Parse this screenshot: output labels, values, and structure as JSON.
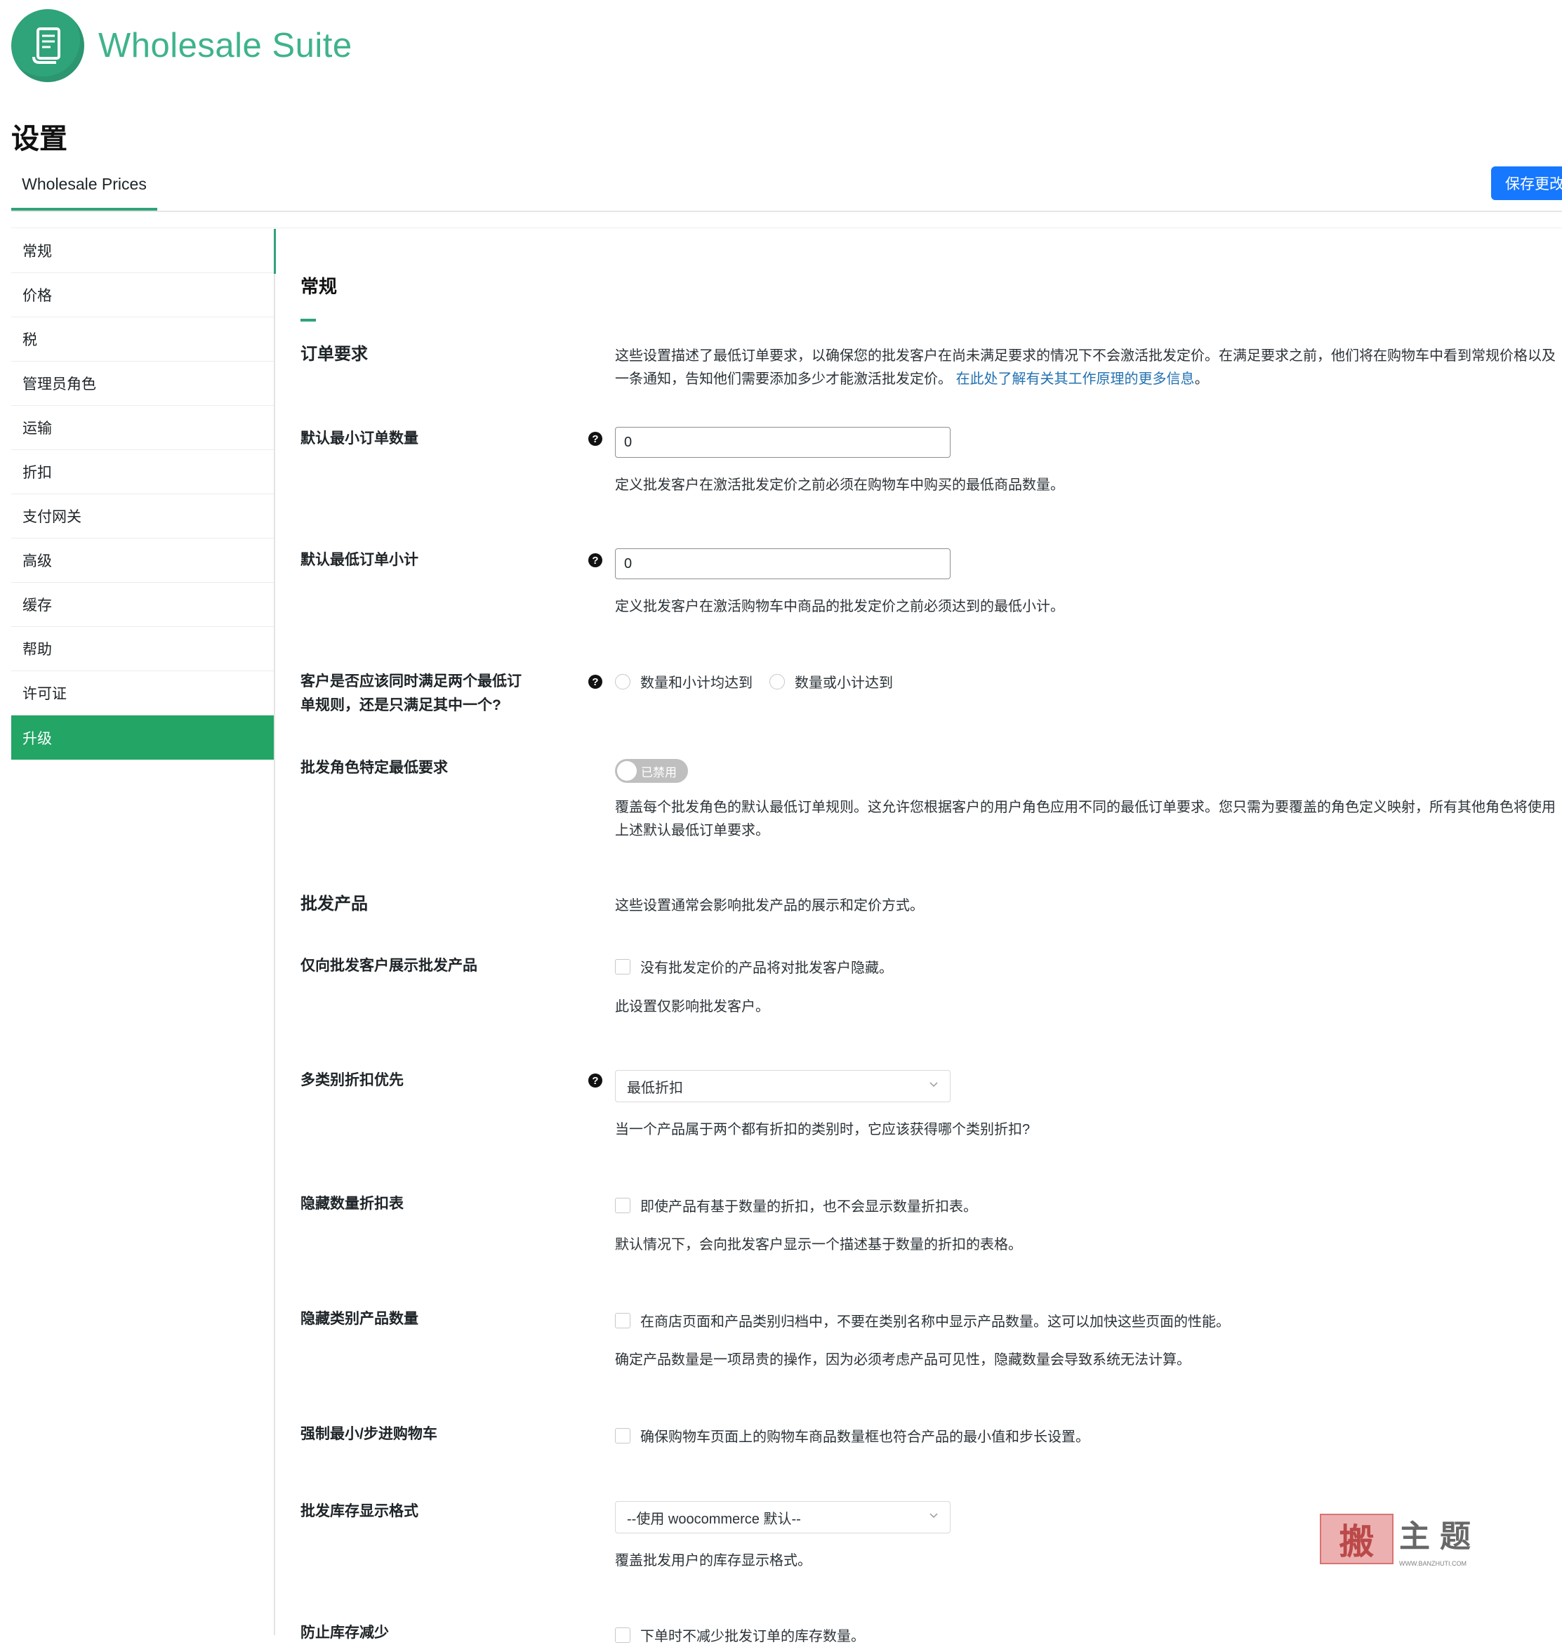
{
  "brand": {
    "name": "Wholesale Suite",
    "color": "#2fa37a"
  },
  "page": {
    "title": "设置"
  },
  "tabs": [
    {
      "label": "Wholesale Prices"
    }
  ],
  "toolbar": {
    "save_label": "保存更改"
  },
  "sidebar": {
    "items": [
      {
        "label": "常规"
      },
      {
        "label": "价格"
      },
      {
        "label": "税"
      },
      {
        "label": "管理员角色"
      },
      {
        "label": "运输"
      },
      {
        "label": "折扣"
      },
      {
        "label": "支付网关"
      },
      {
        "label": "高级"
      },
      {
        "label": "缓存"
      },
      {
        "label": "帮助"
      },
      {
        "label": "许可证"
      },
      {
        "label": "升级"
      }
    ]
  },
  "main": {
    "section_title": "常规",
    "order_requirements": {
      "label": "订单要求",
      "desc": "这些设置描述了最低订单要求，以确保您的批发客户在尚未满足要求的情况下不会激活批发定价。在满足要求之前，他们将在购物车中看到常规价格以及一条通知，告知他们需要添加多少才能激活批发定价。",
      "link": "在此处了解有关其工作原理的更多信息",
      "link_end": "。"
    },
    "min_qty": {
      "label": "默认最小订单数量",
      "value": "0",
      "desc": "定义批发客户在激活批发定价之前必须在购物车中购买的最低商品数量。"
    },
    "min_subtotal": {
      "label": "默认最低订单小计",
      "value": "0",
      "desc": "定义批发客户在激活购物车中商品的批发定价之前必须达到的最低小计。"
    },
    "rule_logic": {
      "label": "客户是否应该同时满足两个最低订单规则，还是只满足其中一个?",
      "option_and": "数量和小计均达到",
      "option_or": "数量或小计达到"
    },
    "role_min": {
      "label": "批发角色特定最低要求",
      "toggle_text": "已禁用",
      "desc": "覆盖每个批发角色的默认最低订单规则。这允许您根据客户的用户角色应用不同的最低订单要求。您只需为要覆盖的角色定义映射，所有其他角色将使用上述默认最低订单要求。"
    },
    "wholesale_products": {
      "label": "批发产品",
      "desc": "这些设置通常会影响批发产品的展示和定价方式。"
    },
    "only_show_wholesale": {
      "label": "仅向批发客户展示批发产品",
      "checkbox": "没有批发定价的产品将对批发客户隐藏。",
      "desc": "此设置仅影响批发客户。"
    },
    "category_discount": {
      "label": "多类别折扣优先",
      "selected": "最低折扣",
      "desc": "当一个产品属于两个都有折扣的类别时，它应该获得哪个类别折扣?"
    },
    "hide_qty_table": {
      "label": "隐藏数量折扣表",
      "checkbox": "即使产品有基于数量的折扣，也不会显示数量折扣表。",
      "desc": "默认情况下，会向批发客户显示一个描述基于数量的折扣的表格。"
    },
    "hide_cat_count": {
      "label": "隐藏类别产品数量",
      "checkbox": "在商店页面和产品类别归档中，不要在类别名称中显示产品数量。这可以加快这些页面的性能。",
      "desc": "确定产品数量是一项昂贵的操作，因为必须考虑产品可见性，隐藏数量会导致系统无法计算。"
    },
    "enforce_min_step": {
      "label": "强制最小/步进购物车",
      "checkbox": "确保购物车页面上的购物车商品数量框也符合产品的最小值和步长设置。"
    },
    "stock_format": {
      "label": "批发库存显示格式",
      "selected": "--使用 woocommerce 默认--",
      "desc": "覆盖批发用户的库存显示格式。"
    },
    "prevent_stock_reduce": {
      "label": "防止库存减少",
      "checkbox": "下单时不减少批发订单的库存数量。"
    }
  },
  "watermark": {
    "glyph": "搬",
    "text": "主题",
    "url": "WWW.BANZHUTI.COM"
  }
}
